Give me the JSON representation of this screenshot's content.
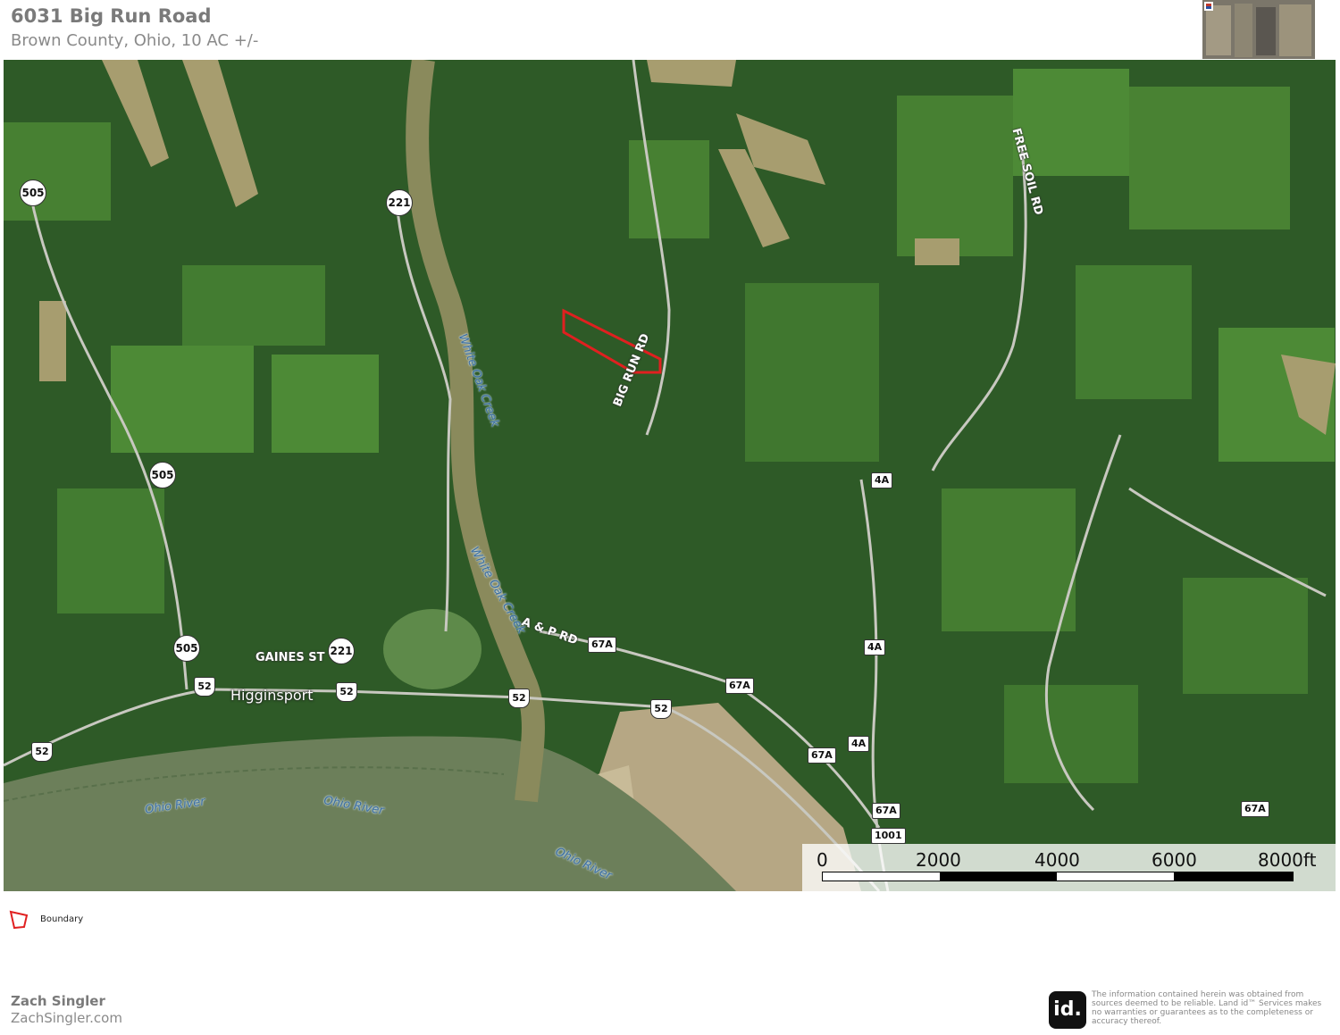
{
  "header": {
    "title": "6031 Big Run Road",
    "subtitle": "Brown County, Ohio, 10 AC +/-"
  },
  "map": {
    "roads": {
      "big_run_rd": "BIG RUN RD",
      "free_soil_rd": "FREE SOIL RD",
      "a_p_rd": "A & P RD",
      "gaines_st": "GAINES ST"
    },
    "water": {
      "white_oak_creek_1": "White Oak Creek",
      "white_oak_creek_2": "White Oak Creek",
      "ohio_river_1": "Ohio River",
      "ohio_river_2": "Ohio River",
      "ohio_river_3": "Ohio River"
    },
    "town": "Higginsport",
    "shields": {
      "sr505_a": "505",
      "sr505_b": "505",
      "sr505_c": "505",
      "sr221_a": "221",
      "sr221_b": "221",
      "us52_a": "52",
      "us52_b": "52",
      "us52_c": "52",
      "us52_d": "52",
      "us52_e": "52",
      "r67a_a": "67A",
      "r67a_b": "67A",
      "r67a_c": "67A",
      "r67a_d": "67A",
      "r67a_e": "67A",
      "r4a_a": "4A",
      "r4a_b": "4A",
      "r4a_c": "4A",
      "r1001": "1001"
    },
    "scale": {
      "labels": [
        "0",
        "2000",
        "4000",
        "6000",
        "8000ft"
      ]
    }
  },
  "legend": {
    "boundary_label": "Boundary",
    "boundary_color": "#e02020"
  },
  "footer": {
    "agent_name": "Zach Singler",
    "agent_site": "ZachSingler.com",
    "id_logo": "id.",
    "disclaimer": "The information contained herein was obtained from sources deemed to be reliable. Land id™ Services makes no warranties or guarantees as to the completeness or accuracy thereof."
  }
}
